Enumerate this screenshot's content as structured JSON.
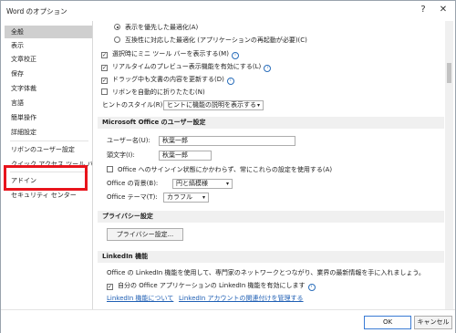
{
  "window": {
    "title": "Word のオプション",
    "help": "?",
    "close": "✕"
  },
  "sidebar": {
    "items": [
      "全般",
      "表示",
      "文章校正",
      "保存",
      "文字体裁",
      "言語",
      "簡単操作",
      "詳細設定",
      "リボンのユーザー設定",
      "クイック アクセス ツール バー",
      "アドイン",
      "セキュリティ センター"
    ]
  },
  "ui": {
    "radio1": "表示を優先した最適化(A)",
    "radio2": "互換性に対応した最適化 (アプリケーションの再起動が必要)(C)",
    "chk_mini": "選択時にミニ ツール バーを表示する(M)",
    "chk_live": "リアルタイムのプレビュー表示機能を有効にする(L)",
    "chk_drag": "ドラッグ中も文書の内容を更新する(D)",
    "chk_wrap": "リボンを自動的に折りたたむ(N)",
    "tooltip_label": "ヒントのスタイル(R):",
    "tooltip_value": "ヒントに機能の説明を表示する",
    "info_icon": "i",
    "check_mark": "✓",
    "dropdown_arrow": "▾"
  },
  "personalize": {
    "header": "Microsoft Office のユーザー設定",
    "username_label": "ユーザー名(U):",
    "username_value": "秋葉一郎",
    "initials_label": "頭文字(I):",
    "initials_value": "秋葉一郎",
    "always_use": "Office へのサインイン状態にかかわらず、常にこれらの設定を使用する(A)",
    "background_label": "Office の背景(B):",
    "background_value": "円と縞模様",
    "theme_label": "Office テーマ(T):",
    "theme_value": "カラフル"
  },
  "privacy": {
    "header": "プライバシー設定",
    "button": "プライバシー設定..."
  },
  "linkedin": {
    "header": "LinkedIn 機能",
    "desc": "Office の LinkedIn 機能を使用して、専門家のネットワークとつながり、業界の最新情報を手に入れましょう。",
    "enable": "自分の Office アプリケーションの LinkedIn 機能を有効にします",
    "link1": "LinkedIn 機能について",
    "link2": "LinkedIn アカウントの関連付けを管理する"
  },
  "footer": {
    "ok": "OK",
    "cancel": "キャンセル"
  },
  "colors": {
    "highlight": "#e8141c",
    "link": "#1f5fb4",
    "selected": "#cfcfcf"
  }
}
